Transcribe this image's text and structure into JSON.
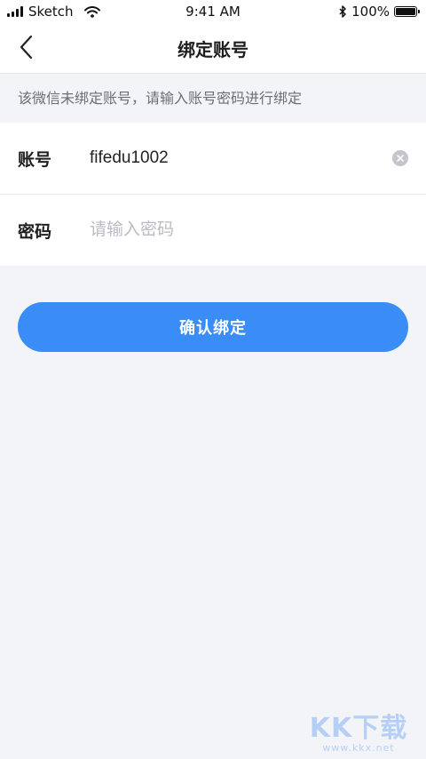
{
  "status_bar": {
    "carrier": "Sketch",
    "time": "9:41 AM",
    "battery": "100%",
    "battery_level": 1.0,
    "icons": [
      "signal-icon",
      "wifi-icon",
      "bluetooth-icon",
      "battery-icon"
    ]
  },
  "nav": {
    "back_icon": "chevron-left-icon",
    "title": "绑定账号"
  },
  "hint": "该微信未绑定账号，请输入账号密码进行绑定",
  "form": {
    "account": {
      "label": "账号",
      "value": "fifedu1002",
      "clear_icon": "clear-icon"
    },
    "password": {
      "label": "密码",
      "value": "",
      "placeholder": "请输入密码"
    }
  },
  "confirm_label": "确认绑定",
  "watermark": {
    "main": "KK下载",
    "sub": "www.kkx.net"
  },
  "colors": {
    "primary": "#3a8cf6",
    "background": "#f3f4f7",
    "hint_text": "#6b6e75",
    "placeholder": "#b9bcc3"
  }
}
